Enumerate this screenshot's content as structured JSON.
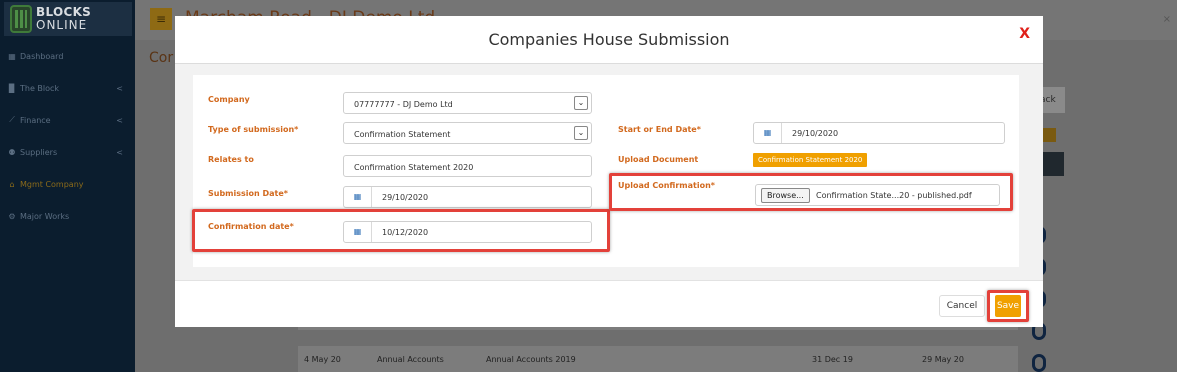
{
  "app": {
    "logo_top": "BLOCKS",
    "logo_bottom": "ONLINE",
    "header_title": "Marcham Road - DJ Demo Ltd",
    "sub_title": "Cor",
    "bg_button_text": "ack"
  },
  "sidebar": {
    "items": [
      {
        "icon": "▦",
        "label": "Dashboard",
        "chevron": ""
      },
      {
        "icon": "▉",
        "label": "The Block",
        "chevron": "<"
      },
      {
        "icon": "⟋",
        "label": "Finance",
        "chevron": "<"
      },
      {
        "icon": "⚉",
        "label": "Suppliers",
        "chevron": "<"
      },
      {
        "icon": "⌂",
        "label": "Mgmt Company",
        "chevron": ""
      },
      {
        "icon": "⚙",
        "label": "Major Works",
        "chevron": ""
      }
    ]
  },
  "bg_table": {
    "row": {
      "date": "4 May 20",
      "type": "Annual Accounts",
      "relates": "Annual Accounts 2019",
      "period_end": "31 Dec 19",
      "filed": "29 May 20"
    }
  },
  "modal": {
    "title": "Companies House Submission",
    "close": "X",
    "company_label": "Company",
    "company_value": "07777777 - DJ Demo Ltd",
    "type_label": "Type of submission*",
    "type_value": "Confirmation Statement",
    "relates_label": "Relates to",
    "relates_value": "Confirmation Statement 2020",
    "submission_date_label": "Submission Date*",
    "submission_date_value": "29/10/2020",
    "confirmation_date_label": "Confirmation date*",
    "confirmation_date_value": "10/12/2020",
    "start_end_label": "Start or End Date*",
    "start_end_value": "29/10/2020",
    "upload_doc_label": "Upload Document",
    "upload_doc_badge": "Confirmation Statement 2020",
    "upload_conf_label": "Upload Confirmation*",
    "browse_label": "Browse...",
    "file_name": "Confirmation State...20 - published.pdf",
    "select_arrow": "⌄",
    "calendar_icon": "▦",
    "cancel_label": "Cancel",
    "save_label": "Save"
  },
  "colors": {
    "label_orange": "#d2691e",
    "accent_orange": "#f0a000",
    "highlight_red": "#e3413a",
    "close_red": "#e0201a"
  }
}
